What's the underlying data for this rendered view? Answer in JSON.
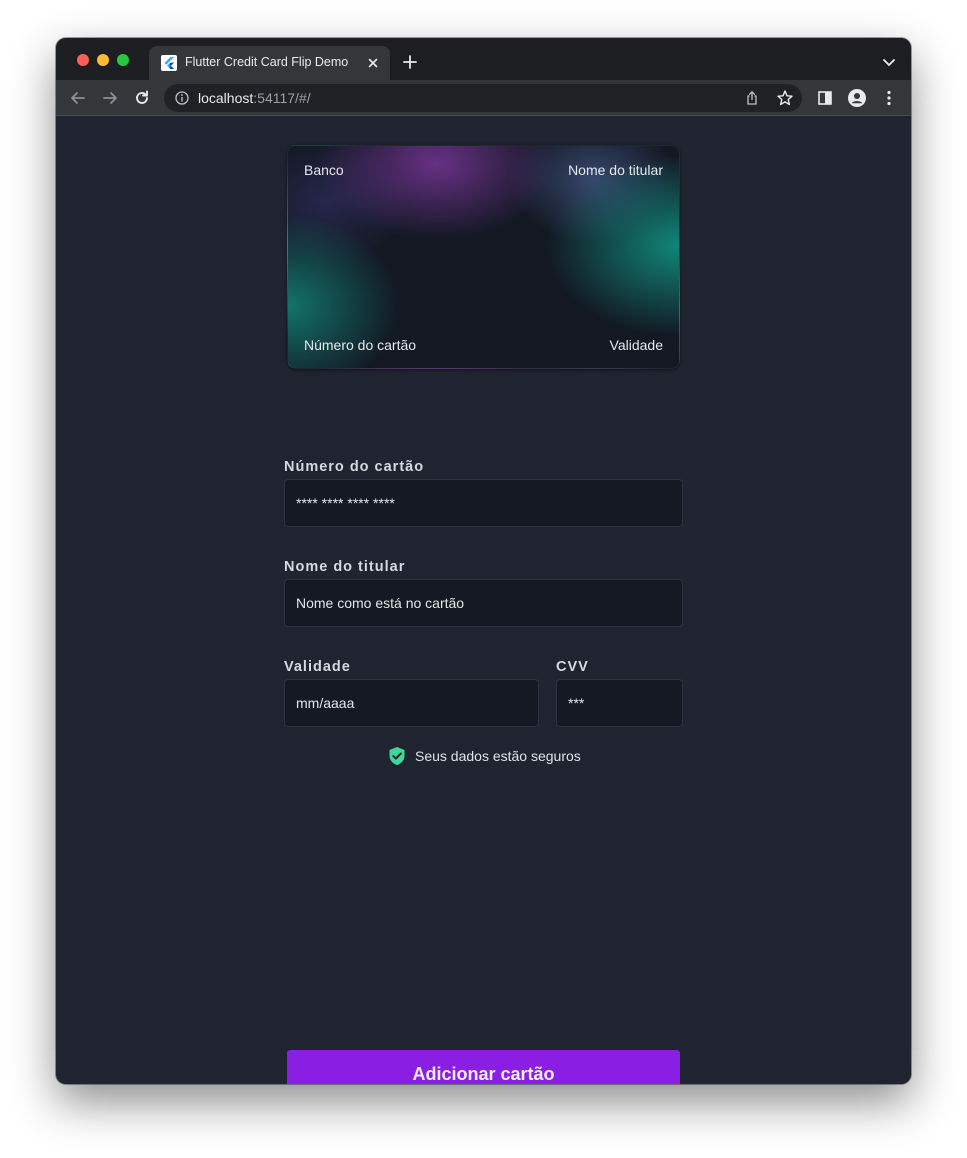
{
  "browser": {
    "tab_title": "Flutter Credit Card Flip Demo",
    "url_host": "localhost",
    "url_rest": ":54117/#/"
  },
  "card": {
    "bank": "Banco",
    "holder_name": "Nome do titular",
    "number": "Número do cartão",
    "expiry": "Validade"
  },
  "form": {
    "card_number": {
      "label": "Número do cartão",
      "placeholder": "**** **** **** ****"
    },
    "holder": {
      "label": "Nome do titular",
      "placeholder": "Nome como está no cartão"
    },
    "expiry": {
      "label": "Validade",
      "placeholder": "mm/aaaa"
    },
    "cvv": {
      "label": "CVV",
      "placeholder": "***"
    }
  },
  "security_note": "Seus dados estão seguros",
  "submit_label": "Adicionar cartão",
  "colors": {
    "background": "#1f2430",
    "accent": "#8a1fe3",
    "shield": "#3fd69a"
  },
  "icons": [
    "back-arrow-icon",
    "forward-arrow-icon",
    "reload-icon",
    "info-icon",
    "share-icon",
    "star-icon",
    "side-panel-icon",
    "profile-icon",
    "kebab-menu-icon",
    "shield-check-icon",
    "flutter-icon"
  ]
}
